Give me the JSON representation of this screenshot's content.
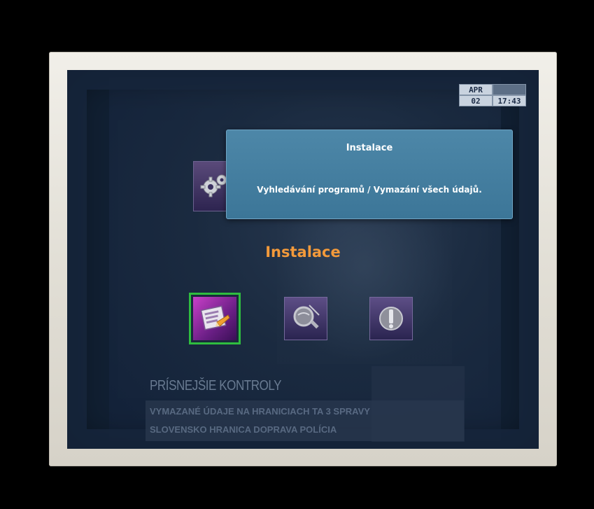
{
  "clock": {
    "month": "APR",
    "day": "02",
    "time": "17:43"
  },
  "tooltip": {
    "title": "Instalace",
    "description": "Vyhledávání programů / Vymazání všech údajů."
  },
  "menu": {
    "title": "Instalace",
    "items": [
      {
        "icon": "installation-wizard-icon",
        "selected": true
      },
      {
        "icon": "channel-search-icon",
        "selected": false
      },
      {
        "icon": "info-icon",
        "selected": false
      }
    ]
  },
  "background_broadcast": {
    "headline": "PRÍSNEJŠIE KONTROLY",
    "ticker_line_1": "VYMAZANÉ ÚDAJE NA HRANICIACH  TA 3  SPRAVY",
    "ticker_line_2": "SLOVENSKO  HRANICA  DOPRAVA  POLÍCIA"
  },
  "colors": {
    "selection_border": "#2fbd3f",
    "title_orange": "#f39a3b",
    "tooltip_blue": "#4d87a8"
  }
}
